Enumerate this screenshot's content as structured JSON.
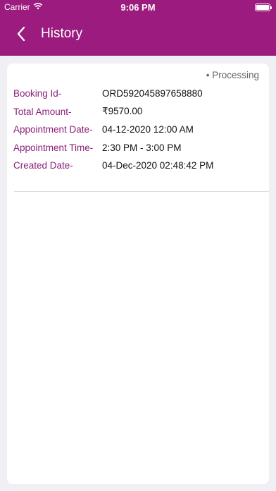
{
  "status_bar": {
    "carrier": "Carrier",
    "time": "9:06 PM"
  },
  "nav": {
    "title": "History"
  },
  "booking": {
    "status": "Processing",
    "fields": [
      {
        "label": "Booking Id-",
        "value": "ORD592045897658880"
      },
      {
        "label": "Total Amount-",
        "value": "₹9570.00"
      },
      {
        "label": "Appointment Date-",
        "value": "04-12-2020 12:00 AM"
      },
      {
        "label": "Appointment Time-",
        "value": "2:30 PM - 3:00 PM"
      },
      {
        "label": "Created Date-",
        "value": "04-Dec-2020 02:48:42 PM"
      }
    ]
  },
  "colors": {
    "header": "#9b1b7e",
    "label": "#8b1f79"
  }
}
